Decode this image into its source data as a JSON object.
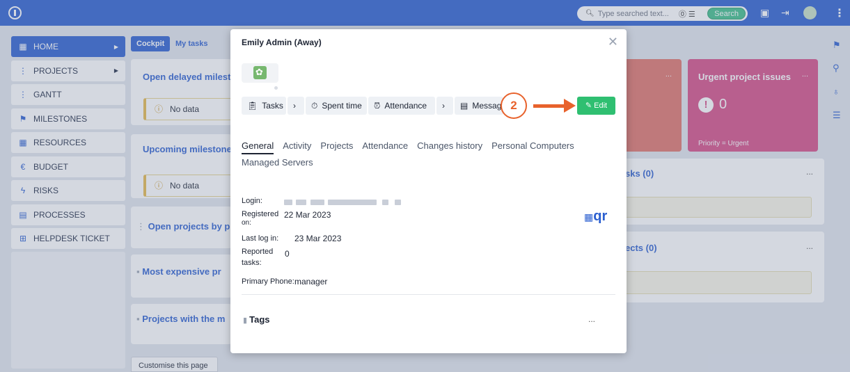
{
  "topbar": {
    "search_placeholder": "Type searched text...",
    "search_button": "Search",
    "icons": [
      "logo-icon",
      "search-icon",
      "help-icon",
      "filter-icon",
      "calendar-icon",
      "logout-icon",
      "avatar",
      "kebab-icon"
    ]
  },
  "sidebar": {
    "items": [
      {
        "label": "HOME",
        "icon": "home-icon"
      },
      {
        "label": "PROJECTS",
        "icon": "projects-icon"
      },
      {
        "label": "GANTT",
        "icon": "gantt-icon"
      },
      {
        "label": "MILESTONES",
        "icon": "flag-icon"
      },
      {
        "label": "RESOURCES",
        "icon": "resources-icon"
      },
      {
        "label": "BUDGET",
        "icon": "euro-icon"
      },
      {
        "label": "RISKS",
        "icon": "bolt-icon"
      },
      {
        "label": "PROCESSES",
        "icon": "processes-icon"
      },
      {
        "label": "HELPDESK TICKET",
        "icon": "plus-icon"
      }
    ]
  },
  "dashboard": {
    "tabs": [
      "Cockpit",
      "My tasks"
    ],
    "widgets": {
      "delayed": "Open delayed milesto",
      "upcoming": "Upcoming milestones",
      "open_projects": "Open projects by p",
      "expensive": "Most expensive pr",
      "projects_with": "Projects with the m"
    },
    "no_data": "No data",
    "urgent_title": "Urgent project issues",
    "urgent_count": "0",
    "urgent_filter": "Priority = Urgent",
    "tasks_title": "sks (0)",
    "projects_title": "ects (0)",
    "customise": "Customise this page",
    "more": "..."
  },
  "modal": {
    "title": "Emily Admin (Away)",
    "toolbar": {
      "tasks": "Tasks",
      "spent_time": "Spent time",
      "attendance": "Attendance",
      "messages": "Messag",
      "edit": "Edit",
      "chevron": "›"
    },
    "tabs": [
      "General",
      "Activity",
      "Projects",
      "Attendance",
      "Changes history",
      "Personal Computers",
      "Managed Servers"
    ],
    "fields": {
      "login_label": "Login:",
      "registered_label_1": "Registered",
      "registered_label_2": "on:",
      "registered_value": "22 Mar 2023",
      "last_login_label": "Last log in:",
      "last_login_value": "23 Mar 2023",
      "reported_label_1": "Reported",
      "reported_label_2": "tasks:",
      "reported_value": "0",
      "phone_label": "Primary Phone:",
      "phone_value": "manager"
    },
    "qr_label": "qr",
    "tags_title": "Tags",
    "tags_more": "..."
  },
  "annotation": {
    "step": "2"
  },
  "colors": {
    "brand": "#2b5fd0",
    "edit": "#2fbf71",
    "callout": "#e8622c",
    "urgent": "#d64d86"
  }
}
